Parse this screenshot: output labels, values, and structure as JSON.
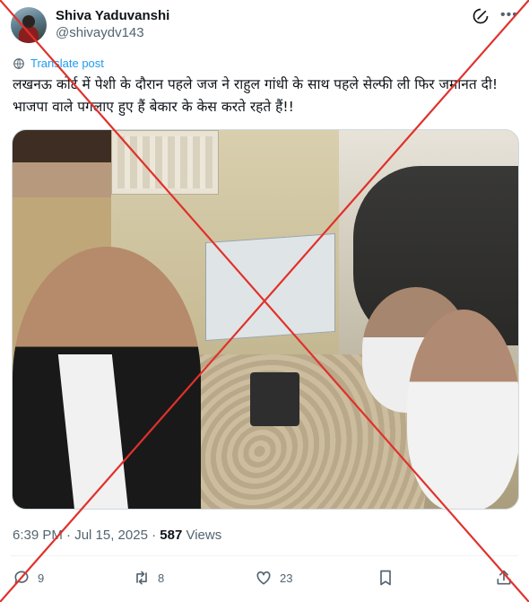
{
  "author": {
    "name": "Shiva Yaduvanshi",
    "handle": "@shivaydv143"
  },
  "translate_label": "Translate post",
  "tweet_text": "लखनऊ कोर्ट में पेशी के दौरान पहले जज ने राहुल गांधी के साथ पहले सेल्फी ली फिर जमानत दी! भाजपा वाले पगलाए हुए हैं बेकार के केस करते रहते हैं!!",
  "meta": {
    "time_date": "6:39 PM · Jul 15, 2025 · ",
    "views_count": "587",
    "views_label": " Views"
  },
  "actions": {
    "replies": "9",
    "reposts": "8",
    "likes": "23"
  },
  "icons": {
    "grok": "grok-icon",
    "more": "more-icon",
    "translate": "globe-icon",
    "reply": "reply-icon",
    "repost": "repost-icon",
    "like": "heart-icon",
    "bookmark": "bookmark-icon",
    "share": "share-icon"
  },
  "colors": {
    "link": "#1d9bf0",
    "secondary_text": "#536471",
    "overlay_cross": "#e0312b"
  }
}
